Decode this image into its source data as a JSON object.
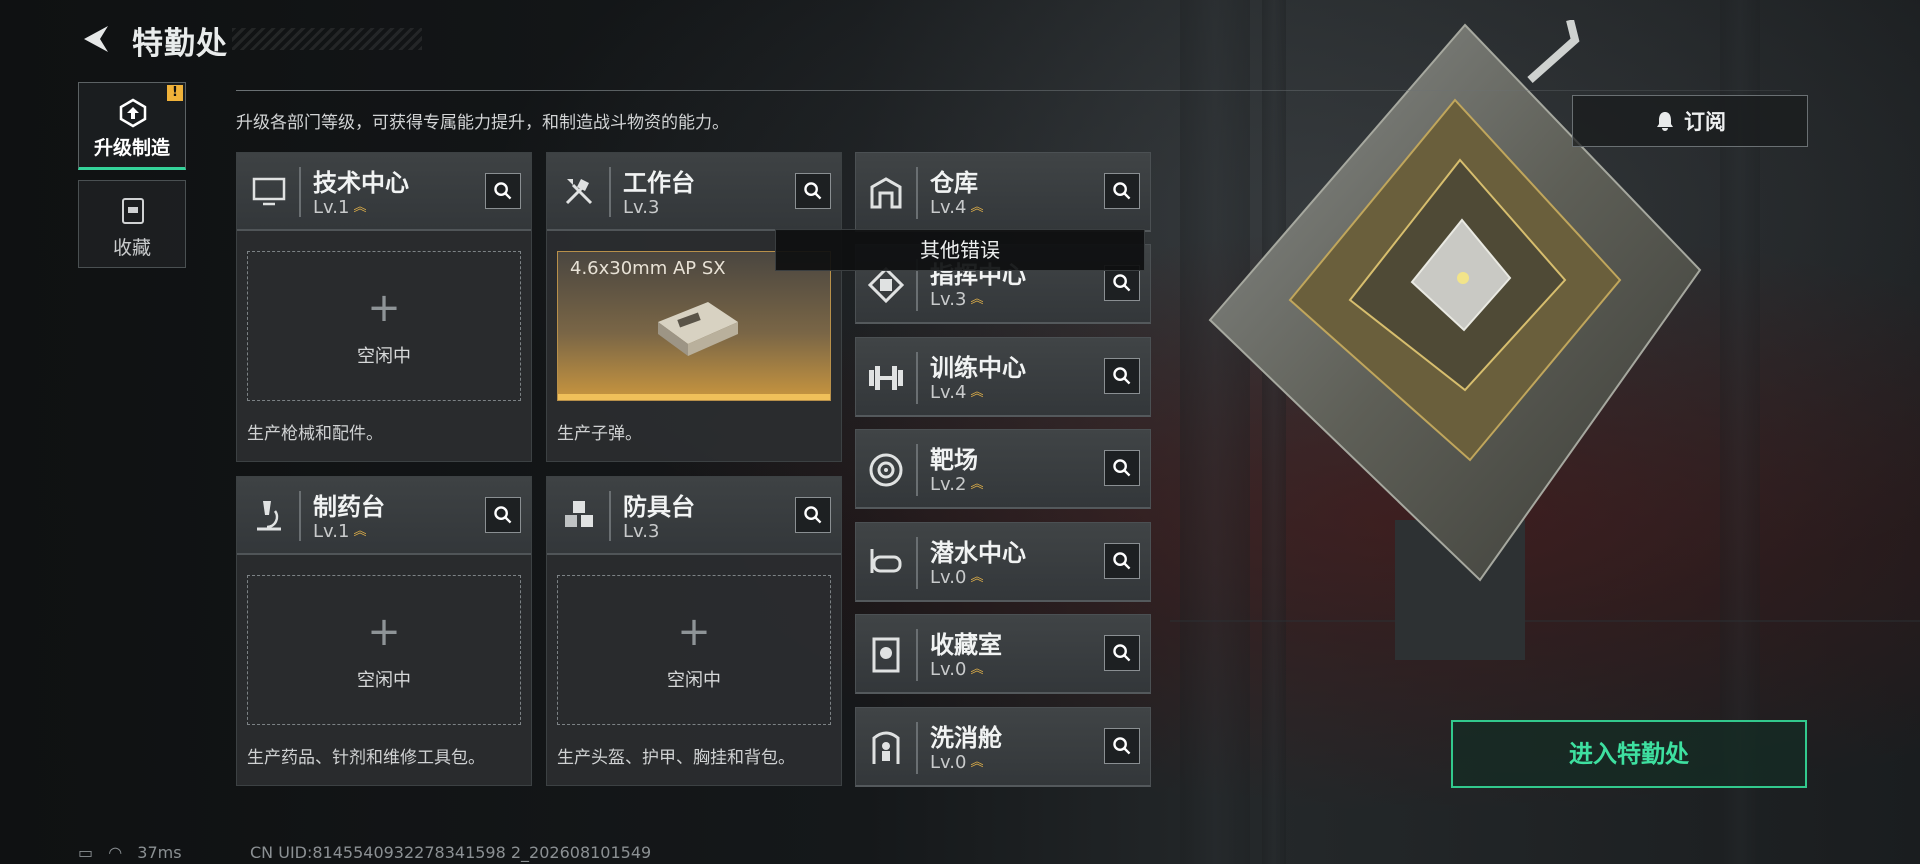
{
  "header": {
    "title": "特勤处"
  },
  "nav": [
    {
      "label": "升级制造",
      "active": true,
      "badge": "!"
    },
    {
      "label": "收藏",
      "active": false
    }
  ],
  "description": "升级各部门等级，可获得专属能力提升，和制造战斗物资的能力。",
  "subscribe": {
    "label": "订阅"
  },
  "cards": {
    "tech": {
      "name": "技术中心",
      "level": "Lv.1",
      "slot_text": "空闲中",
      "desc": "生产枪械和配件。"
    },
    "workbench": {
      "name": "工作台",
      "level": "Lv.3",
      "product": "4.6x30mm AP SX",
      "desc": "生产子弹。",
      "progress": 1.0
    },
    "pharmacy": {
      "name": "制药台",
      "level": "Lv.1",
      "slot_text": "空闲中",
      "desc": "生产药品、针剂和维修工具包。"
    },
    "armor": {
      "name": "防具台",
      "level": "Lv.3",
      "slot_text": "空闲中",
      "desc": "生产头盔、护甲、胸挂和背包。"
    }
  },
  "list": [
    {
      "name": "仓库",
      "level": "Lv.4",
      "icon": "warehouse-icon"
    },
    {
      "name": "指挥中心",
      "level": "Lv.3",
      "icon": "command-icon"
    },
    {
      "name": "训练中心",
      "level": "Lv.4",
      "icon": "dumbbell-icon"
    },
    {
      "name": "靶场",
      "level": "Lv.2",
      "icon": "target-icon"
    },
    {
      "name": "潜水中心",
      "level": "Lv.0",
      "icon": "diving-mask-icon"
    },
    {
      "name": "收藏室",
      "level": "Lv.0",
      "icon": "collection-icon"
    },
    {
      "name": "洗消舱",
      "level": "Lv.0",
      "icon": "decontamination-icon"
    }
  ],
  "tooltip": "其他错误",
  "enter": {
    "label": "进入特勤处"
  },
  "status": {
    "ping": "37ms",
    "uid": "CN UID:8145540932278341598 2_202608101549"
  },
  "colors": {
    "accent_green": "#34d39a",
    "level_gold": "#e3b24a"
  }
}
